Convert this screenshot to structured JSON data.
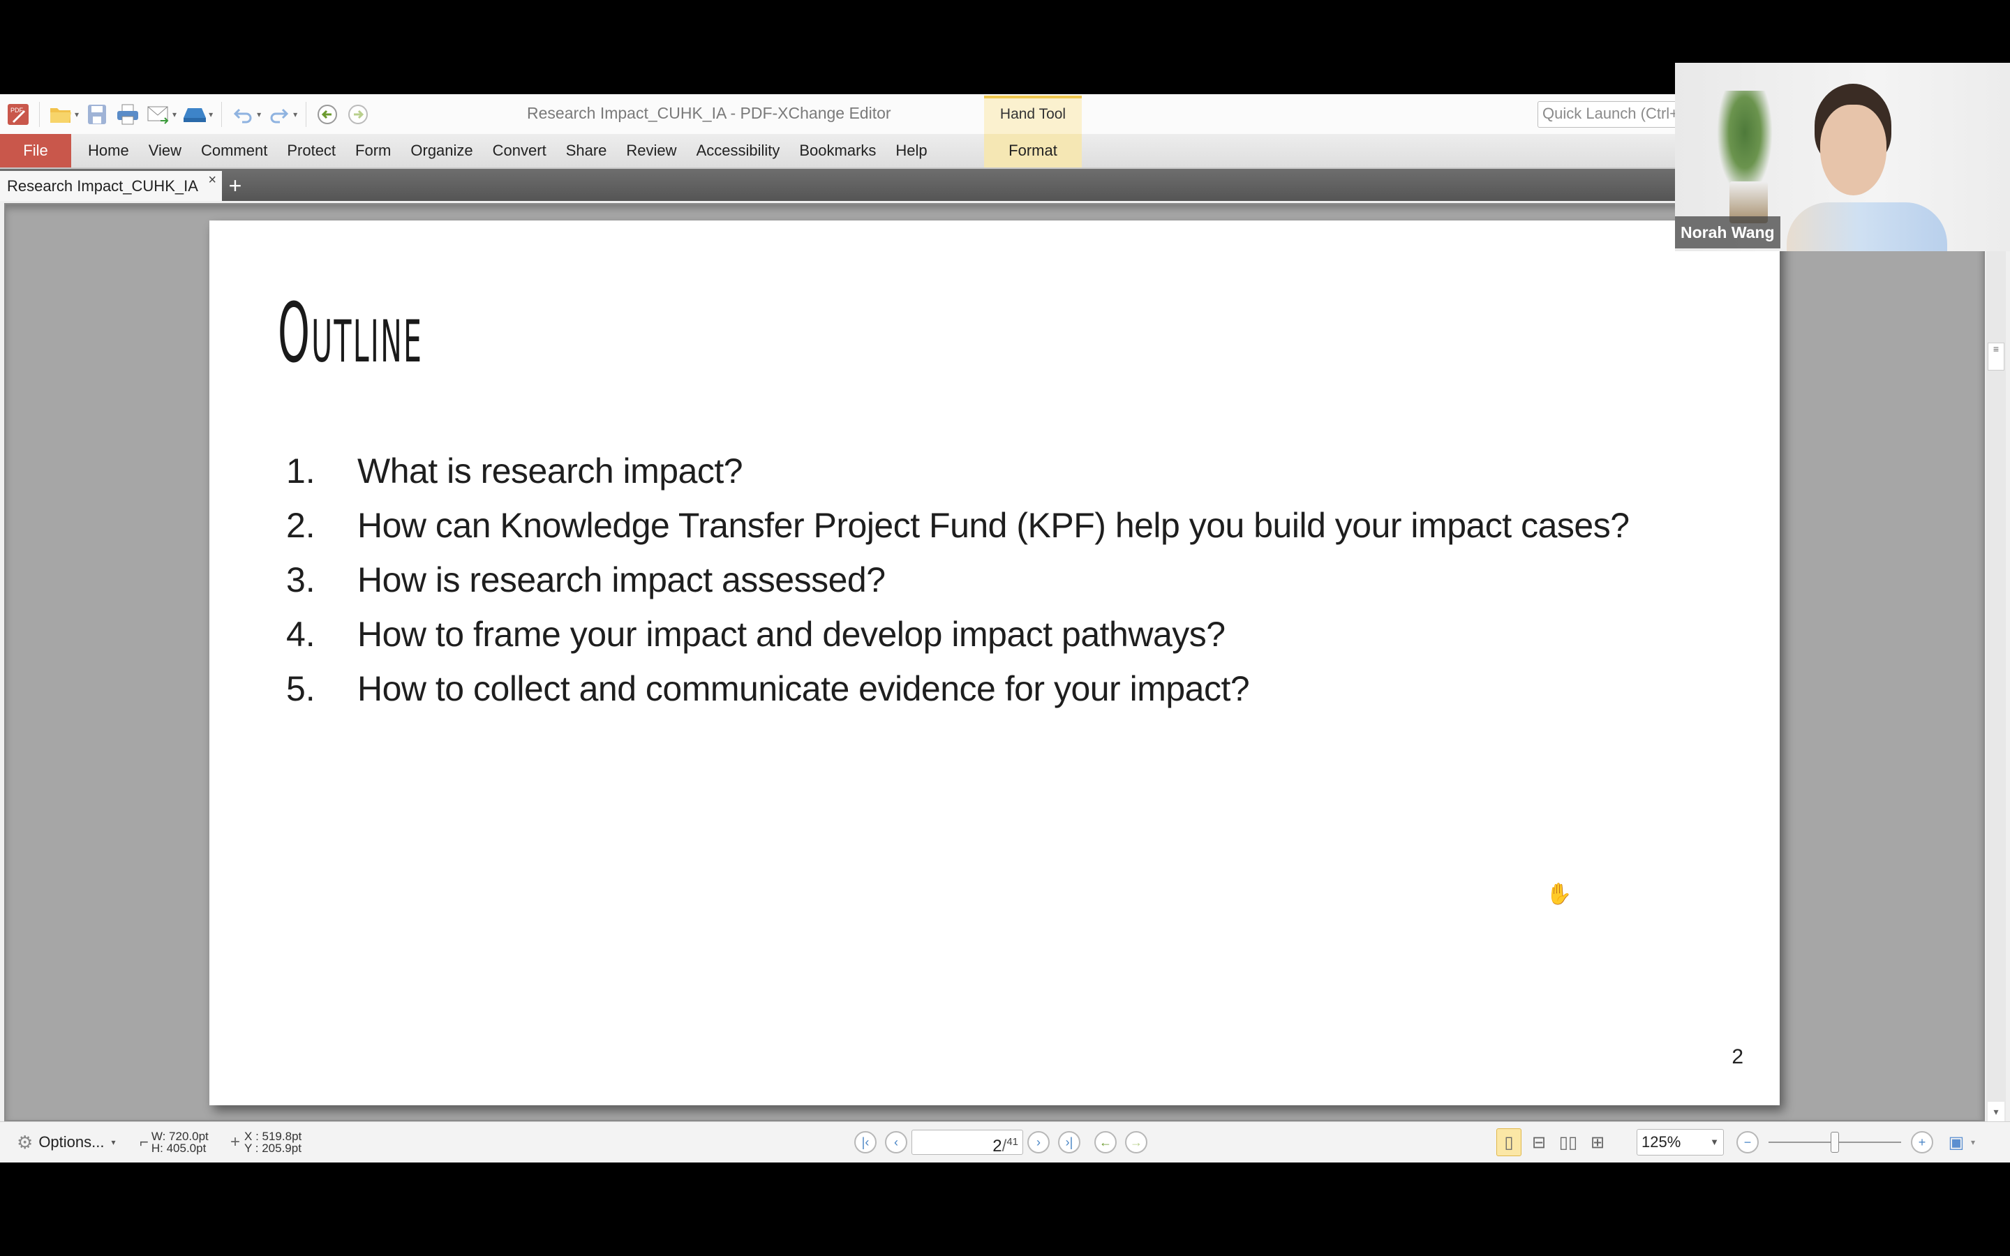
{
  "window": {
    "title": "Research Impact_CUHK_IA - PDF-XChange Editor",
    "context_group_label": "Hand Tool",
    "quick_launch_placeholder": "Quick Launch (Ctrl+"
  },
  "quick_access_toolbar": [
    {
      "icon": "app-logo-icon"
    },
    {
      "icon": "open-folder-icon",
      "dropdown": true
    },
    {
      "icon": "save-icon"
    },
    {
      "icon": "print-icon"
    },
    {
      "icon": "email-icon",
      "dropdown": true
    },
    {
      "icon": "scan-icon",
      "dropdown": true
    },
    {
      "icon": "undo-icon",
      "dropdown": true
    },
    {
      "icon": "redo-icon",
      "dropdown": true
    },
    {
      "icon": "back-icon"
    },
    {
      "icon": "forward-icon"
    }
  ],
  "ribbon": {
    "file_label": "File",
    "tabs": [
      "Home",
      "View",
      "Comment",
      "Protect",
      "Form",
      "Organize",
      "Convert",
      "Share",
      "Review",
      "Accessibility",
      "Bookmarks",
      "Help"
    ],
    "context_tab": "Format"
  },
  "document_tabs": {
    "active": "Research Impact_CUHK_IA",
    "close_glyph": "×",
    "new_tab_glyph": "+"
  },
  "slide": {
    "title": "Outline",
    "items": [
      {
        "num": "1.",
        "text": "What is research impact?"
      },
      {
        "num": "2.",
        "text": "How can Knowledge Transfer Project Fund (KPF) help you build your impact cases?"
      },
      {
        "num": "3.",
        "text": "How is research impact assessed?"
      },
      {
        "num": "4.",
        "text": "How to frame your impact and develop impact pathways?"
      },
      {
        "num": "5.",
        "text": "How to collect and communicate evidence for your impact?"
      }
    ],
    "page_number": "2"
  },
  "statusbar": {
    "options_label": "Options...",
    "page_width": "W: 720.0pt",
    "page_height": "H: 405.0pt",
    "cursor_x": "X : 519.8pt",
    "cursor_y": "Y : 205.9pt",
    "current_page": "2",
    "total_pages": "41",
    "zoom_value": "125%",
    "zoom_slider_fraction": 0.5
  },
  "video": {
    "participant_name": "Norah Wang"
  }
}
